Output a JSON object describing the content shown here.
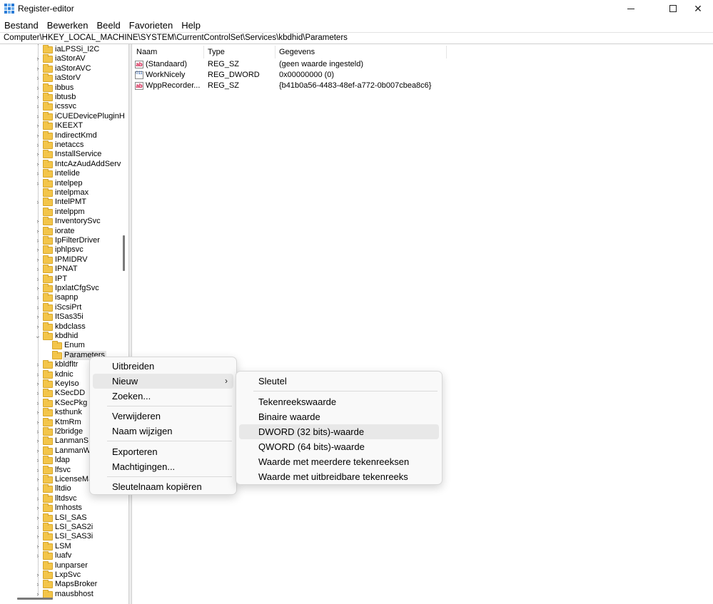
{
  "window": {
    "title": "Register-editor",
    "minimize": "—",
    "maximize": "☐",
    "close": "✕"
  },
  "menu": [
    "Bestand",
    "Bewerken",
    "Beeld",
    "Favorieten",
    "Help"
  ],
  "address": "Computer\\HKEY_LOCAL_MACHINE\\SYSTEM\\CurrentControlSet\\Services\\kbdhid\\Parameters",
  "tree": {
    "items": [
      {
        "label": "iaLPSSi_I2C",
        "expander": ""
      },
      {
        "label": "iaStorAV",
        "expander": "›"
      },
      {
        "label": "iaStorAVC",
        "expander": "›"
      },
      {
        "label": "iaStorV",
        "expander": "›"
      },
      {
        "label": "ibbus",
        "expander": "›"
      },
      {
        "label": "ibtusb",
        "expander": "›"
      },
      {
        "label": "icssvc",
        "expander": "›"
      },
      {
        "label": "iCUEDevicePluginH",
        "expander": "›"
      },
      {
        "label": "IKEEXT",
        "expander": "›"
      },
      {
        "label": "IndirectKmd",
        "expander": "›"
      },
      {
        "label": "inetaccs",
        "expander": "›"
      },
      {
        "label": "InstallService",
        "expander": "›"
      },
      {
        "label": "IntcAzAudAddServ",
        "expander": "›"
      },
      {
        "label": "intelide",
        "expander": "›"
      },
      {
        "label": "intelpep",
        "expander": "›"
      },
      {
        "label": "intelpmax",
        "expander": ""
      },
      {
        "label": "IntelPMT",
        "expander": "›"
      },
      {
        "label": "intelppm",
        "expander": ""
      },
      {
        "label": "InventorySvc",
        "expander": "›"
      },
      {
        "label": "iorate",
        "expander": "›"
      },
      {
        "label": "IpFilterDriver",
        "expander": "›"
      },
      {
        "label": "iphlpsvc",
        "expander": "›"
      },
      {
        "label": "IPMIDRV",
        "expander": "›"
      },
      {
        "label": "IPNAT",
        "expander": "›"
      },
      {
        "label": "IPT",
        "expander": "›"
      },
      {
        "label": "IpxlatCfgSvc",
        "expander": "›"
      },
      {
        "label": "isapnp",
        "expander": "›"
      },
      {
        "label": "iScsiPrt",
        "expander": "›"
      },
      {
        "label": "ItSas35i",
        "expander": "›"
      },
      {
        "label": "kbdclass",
        "expander": "›"
      },
      {
        "label": "kbdhid",
        "expander": "⌄"
      },
      {
        "label": "Enum",
        "expander": "",
        "child": true
      },
      {
        "label": "Parameters",
        "expander": "",
        "child": true,
        "selected": true
      },
      {
        "label": "kbldfltr",
        "expander": "›"
      },
      {
        "label": "kdnic",
        "expander": "›"
      },
      {
        "label": "KeyIso",
        "expander": "›"
      },
      {
        "label": "KSecDD",
        "expander": "›"
      },
      {
        "label": "KSecPkg",
        "expander": "›"
      },
      {
        "label": "ksthunk",
        "expander": "›"
      },
      {
        "label": "KtmRm",
        "expander": "›"
      },
      {
        "label": "l2bridge",
        "expander": "›"
      },
      {
        "label": "LanmanS",
        "expander": "›"
      },
      {
        "label": "LanmanW",
        "expander": "›"
      },
      {
        "label": "ldap",
        "expander": "›"
      },
      {
        "label": "lfsvc",
        "expander": "›"
      },
      {
        "label": "LicenseMa",
        "expander": "›"
      },
      {
        "label": "lltdio",
        "expander": "›"
      },
      {
        "label": "lltdsvc",
        "expander": "›"
      },
      {
        "label": "lmhosts",
        "expander": "›"
      },
      {
        "label": "LSI_SAS",
        "expander": "›"
      },
      {
        "label": "LSI_SAS2i",
        "expander": "›"
      },
      {
        "label": "LSI_SAS3i",
        "expander": "›"
      },
      {
        "label": "LSM",
        "expander": "›"
      },
      {
        "label": "luafv",
        "expander": "›"
      },
      {
        "label": "lunparser",
        "expander": ""
      },
      {
        "label": "LxpSvc",
        "expander": "›"
      },
      {
        "label": "MapsBroker",
        "expander": "›"
      },
      {
        "label": "mausbhost",
        "expander": "›"
      }
    ]
  },
  "list": {
    "columns": [
      "Naam",
      "Type",
      "Gegevens"
    ],
    "rows": [
      {
        "icon": "ab",
        "kind": "sz",
        "name": "(Standaard)",
        "type": "REG_SZ",
        "data": "(geen waarde ingesteld)"
      },
      {
        "icon": "011",
        "kind": "dw",
        "name": "WorkNicely",
        "type": "REG_DWORD",
        "data": "0x00000000 (0)"
      },
      {
        "icon": "ab",
        "kind": "sz",
        "name": "WppRecorder...",
        "type": "REG_SZ",
        "data": "{b41b0a56-4483-48ef-a772-0b007cbea8c6}"
      }
    ]
  },
  "context_menu": {
    "items": [
      "Uitbreiden",
      "Nieuw",
      "Zoeken...",
      "Verwijderen",
      "Naam wijzigen",
      "Exporteren",
      "Machtigingen...",
      "Sleutelnaam kopiëren"
    ],
    "submenu_arrow": "›"
  },
  "submenu": {
    "items": [
      "Sleutel",
      "Tekenreekswaarde",
      "Binaire waarde",
      "DWORD (32 bits)-waarde",
      "QWORD (64 bits)-waarde",
      "Waarde met meerdere tekenreeksen",
      "Waarde met uitbreidbare tekenreeks"
    ]
  }
}
